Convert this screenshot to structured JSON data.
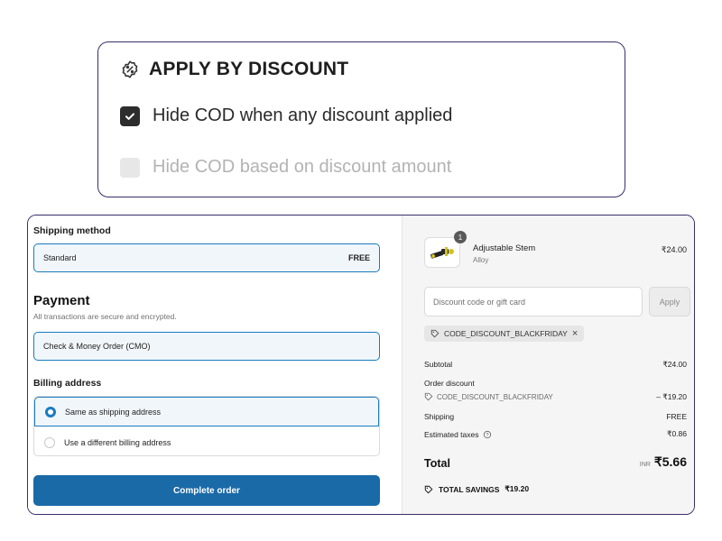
{
  "settings": {
    "title": "APPLY BY DISCOUNT",
    "icon": "discount-badge-icon",
    "options": [
      {
        "label": "Hide COD when any discount applied",
        "checked": true,
        "enabled": true
      },
      {
        "label": "Hide COD based on discount amount",
        "checked": false,
        "enabled": false
      }
    ]
  },
  "checkout": {
    "shipping": {
      "heading": "Shipping method",
      "method": "Standard",
      "price": "FREE"
    },
    "payment": {
      "heading": "Payment",
      "note": "All transactions are secure and encrypted.",
      "selected": "Check & Money Order (CMO)"
    },
    "billing": {
      "heading": "Billing address",
      "options": [
        {
          "label": "Same as shipping address",
          "selected": true
        },
        {
          "label": "Use a different billing address",
          "selected": false
        }
      ]
    },
    "complete_button": "Complete order"
  },
  "summary": {
    "item": {
      "name": "Adjustable Stem",
      "variant": "Alloy",
      "price": "₹24.00",
      "quantity": "1"
    },
    "discount_placeholder": "Discount code or gift card",
    "apply_label": "Apply",
    "applied_code": "CODE_DISCOUNT_BLACKFRIDAY",
    "chip_close": "×",
    "subtotal_label": "Subtotal",
    "subtotal_value": "₹24.00",
    "order_discount_label": "Order discount",
    "order_discount_code": "CODE_DISCOUNT_BLACKFRIDAY",
    "order_discount_value": "– ₹19.20",
    "shipping_label": "Shipping",
    "shipping_value": "FREE",
    "taxes_label": "Estimated taxes",
    "taxes_value": "₹0.86",
    "total_label": "Total",
    "total_currency": "INR",
    "total_value": "₹5.66",
    "savings_label": "TOTAL SAVINGS",
    "savings_value": "₹19.20"
  },
  "colors": {
    "card_border": "#3b2d6b",
    "accent": "#1a7bbf",
    "button": "#1a6aa8"
  }
}
